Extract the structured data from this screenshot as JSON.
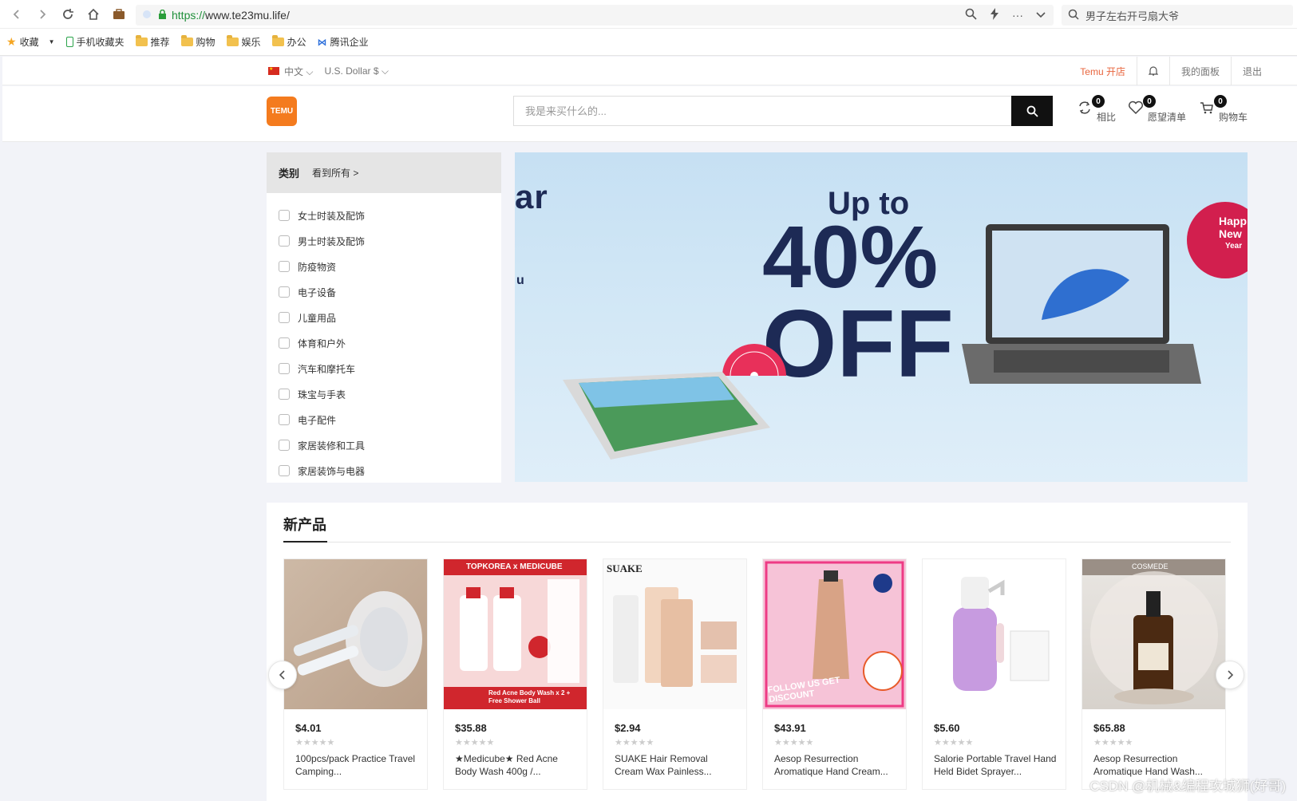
{
  "browser": {
    "url_scheme": "https://",
    "url_rest": "www.te23mu.life/",
    "search_text": "男子左右开弓扇大爷",
    "bookmarks": [
      "收藏",
      "手机收藏夹",
      "推荐",
      "购物",
      "娱乐",
      "办公",
      "腾讯企业"
    ]
  },
  "topbar": {
    "language": "中文",
    "currency": "U.S. Dollar $",
    "links": [
      "Temu 开店",
      "我的面板",
      "退出"
    ]
  },
  "header": {
    "logo_text": "TEMU",
    "search_placeholder": "我是来买什么的...",
    "compare": {
      "label": "相比",
      "count": "0"
    },
    "wishlist": {
      "label": "愿望清单",
      "count": "0"
    },
    "cart": {
      "label": "购物车",
      "count": "0"
    }
  },
  "categories": {
    "title": "类别",
    "view_all": "看到所有 >",
    "items": [
      "女士时装及配饰",
      "男士时装及配饰",
      "防疫物资",
      "电子设备",
      "儿童用品",
      "体育和户外",
      "汽车和摩托车",
      "珠宝与手表",
      "电子配件",
      "家居装修和工具",
      "家居装饰与电器"
    ]
  },
  "banner": {
    "partial_left": "ar",
    "partial_u": "u",
    "upto": "Up to",
    "percent": "40%",
    "off": "OFF",
    "badge_lines": [
      "Happ",
      "New",
      "Year"
    ]
  },
  "products": {
    "title": "新产品",
    "items": [
      {
        "price": "$4.01",
        "name": "100pcs/pack Practice Travel Camping..."
      },
      {
        "price": "$35.88",
        "name": "★Medicube★ Red Acne Body Wash 400g /..."
      },
      {
        "price": "$2.94",
        "name": "SUAKE Hair Removal Cream Wax Painless..."
      },
      {
        "price": "$43.91",
        "name": "Aesop Resurrection Aromatique Hand Cream..."
      },
      {
        "price": "$5.60",
        "name": "Salorie Portable Travel Hand Held Bidet Sprayer..."
      },
      {
        "price": "$65.88",
        "name": "Aesop Resurrection Aromatique Hand Wash..."
      }
    ],
    "img_labels": {
      "p2_brand": "TOPKOREA x MEDICUBE",
      "p2_bottom": "Red Acne Body Wash x 2 + Free Shower Ball",
      "p3_brand": "SUAKE",
      "p4_promo": "FOLLOW US GET DISCOUNT",
      "p6_brand": "COSMEDE"
    }
  },
  "watermark": "CSDN @机械&编程攻城狮(好哥)",
  "colors": {
    "accent": "#f47b1e",
    "banner_text": "#1d2a55",
    "link_orange": "#e8643c"
  }
}
